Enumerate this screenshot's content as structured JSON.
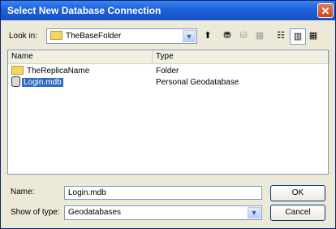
{
  "window": {
    "title": "Select New Database Connection",
    "close": "✕"
  },
  "lookin": {
    "label": "Look in:",
    "value": "TheBaseFolder"
  },
  "toolbar": {
    "up": "⬆",
    "connect": "⛃",
    "disconnect": "⛁",
    "new": "▦",
    "list": "☷",
    "details": "▥",
    "thumbs": "▦"
  },
  "list": {
    "columns": [
      "Name",
      "Type"
    ],
    "rows": [
      {
        "name": "TheReplicaName",
        "type": "Folder"
      },
      {
        "name": "Login.mdb",
        "type": "Personal Geodatabase"
      }
    ]
  },
  "form": {
    "name_label": "Name:",
    "name_value": "Login.mdb",
    "type_label": "Show of type:",
    "type_value": "Geodatabases"
  },
  "buttons": {
    "ok": "OK",
    "cancel": "Cancel"
  }
}
